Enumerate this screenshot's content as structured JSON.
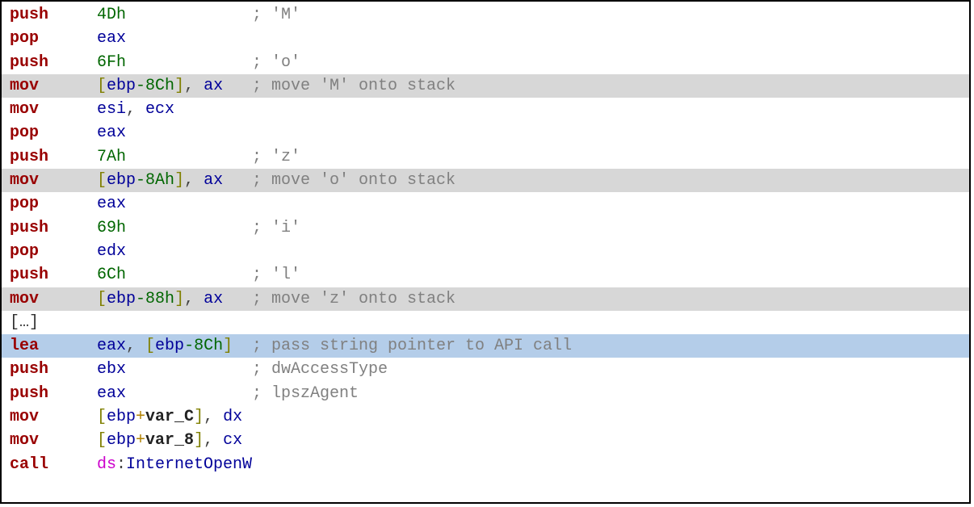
{
  "lines": [
    {
      "hl": "",
      "op": "push",
      "args": [
        {
          "t": "num",
          "v": "4Dh"
        },
        {
          "t": "txt",
          "v": " "
        }
      ],
      "rest": [
        {
          "t": "comment",
          "v": "; 'M'"
        }
      ]
    },
    {
      "hl": "",
      "op": "pop",
      "args": [
        {
          "t": "reg",
          "v": "eax"
        }
      ],
      "rest": []
    },
    {
      "hl": "",
      "op": "push",
      "args": [
        {
          "t": "num",
          "v": "6Fh"
        },
        {
          "t": "txt",
          "v": " "
        }
      ],
      "rest": [
        {
          "t": "comment",
          "v": "; 'o'"
        }
      ]
    },
    {
      "hl": "gray",
      "op": "mov",
      "args": [
        {
          "t": "bracket",
          "v": "["
        },
        {
          "t": "reg",
          "v": "ebp"
        },
        {
          "t": "minus",
          "v": "-"
        },
        {
          "t": "num",
          "v": "8Ch"
        },
        {
          "t": "bracket",
          "v": "]"
        },
        {
          "t": "punct",
          "v": ", "
        },
        {
          "t": "reg",
          "v": "ax"
        }
      ],
      "rest": [
        {
          "t": "comment",
          "v": "; move 'M' onto stack"
        }
      ]
    },
    {
      "hl": "",
      "op": "mov",
      "args": [
        {
          "t": "reg",
          "v": "esi"
        },
        {
          "t": "punct",
          "v": ", "
        },
        {
          "t": "reg",
          "v": "ecx"
        }
      ],
      "rest": []
    },
    {
      "hl": "",
      "op": "pop",
      "args": [
        {
          "t": "reg",
          "v": "eax"
        }
      ],
      "rest": []
    },
    {
      "hl": "",
      "op": "push",
      "args": [
        {
          "t": "num",
          "v": "7Ah"
        },
        {
          "t": "txt",
          "v": " "
        }
      ],
      "rest": [
        {
          "t": "comment",
          "v": "; 'z'"
        }
      ]
    },
    {
      "hl": "gray",
      "op": "mov",
      "args": [
        {
          "t": "bracket",
          "v": "["
        },
        {
          "t": "reg",
          "v": "ebp"
        },
        {
          "t": "minus",
          "v": "-"
        },
        {
          "t": "num",
          "v": "8Ah"
        },
        {
          "t": "bracket",
          "v": "]"
        },
        {
          "t": "punct",
          "v": ", "
        },
        {
          "t": "reg",
          "v": "ax"
        }
      ],
      "rest": [
        {
          "t": "comment",
          "v": "; move 'o' onto stack"
        }
      ]
    },
    {
      "hl": "",
      "op": "pop",
      "args": [
        {
          "t": "reg",
          "v": "eax"
        }
      ],
      "rest": []
    },
    {
      "hl": "",
      "op": "push",
      "args": [
        {
          "t": "num",
          "v": "69h"
        },
        {
          "t": "txt",
          "v": " "
        }
      ],
      "rest": [
        {
          "t": "comment",
          "v": "; 'i'"
        }
      ]
    },
    {
      "hl": "",
      "op": "pop",
      "args": [
        {
          "t": "reg",
          "v": "edx"
        }
      ],
      "rest": []
    },
    {
      "hl": "",
      "op": "push",
      "args": [
        {
          "t": "num",
          "v": "6Ch"
        },
        {
          "t": "txt",
          "v": " "
        }
      ],
      "rest": [
        {
          "t": "comment",
          "v": "; 'l'"
        }
      ]
    },
    {
      "hl": "gray",
      "op": "mov",
      "args": [
        {
          "t": "bracket",
          "v": "["
        },
        {
          "t": "reg",
          "v": "ebp"
        },
        {
          "t": "minus",
          "v": "-"
        },
        {
          "t": "num",
          "v": "88h"
        },
        {
          "t": "bracket",
          "v": "]"
        },
        {
          "t": "punct",
          "v": ", "
        },
        {
          "t": "reg",
          "v": "ax"
        }
      ],
      "rest": [
        {
          "t": "comment",
          "v": "; move 'z' onto stack"
        }
      ]
    },
    {
      "hl": "",
      "op": "",
      "args": [],
      "rest": [],
      "ellipsis": "[…]"
    },
    {
      "hl": "blue",
      "op": "lea",
      "args": [
        {
          "t": "reg",
          "v": "eax"
        },
        {
          "t": "punct",
          "v": ", "
        },
        {
          "t": "bracket",
          "v": "["
        },
        {
          "t": "reg",
          "v": "ebp"
        },
        {
          "t": "minus",
          "v": "-"
        },
        {
          "t": "num",
          "v": "8Ch"
        },
        {
          "t": "bracket",
          "v": "]"
        }
      ],
      "rest": [
        {
          "t": "comment",
          "v": "; pass string pointer to API call"
        }
      ]
    },
    {
      "hl": "",
      "op": "push",
      "args": [
        {
          "t": "reg",
          "v": "ebx"
        }
      ],
      "rest": [
        {
          "t": "comment",
          "v": "; dwAccessType"
        }
      ]
    },
    {
      "hl": "",
      "op": "push",
      "args": [
        {
          "t": "reg",
          "v": "eax"
        }
      ],
      "rest": [
        {
          "t": "comment",
          "v": "; lpszAgent"
        }
      ]
    },
    {
      "hl": "",
      "op": "mov",
      "args": [
        {
          "t": "bracket",
          "v": "["
        },
        {
          "t": "reg",
          "v": "ebp"
        },
        {
          "t": "plus",
          "v": "+"
        },
        {
          "t": "varname",
          "v": "var_C"
        },
        {
          "t": "bracket",
          "v": "]"
        },
        {
          "t": "punct",
          "v": ", "
        },
        {
          "t": "reg",
          "v": "dx"
        }
      ],
      "rest": []
    },
    {
      "hl": "",
      "op": "mov",
      "args": [
        {
          "t": "bracket",
          "v": "["
        },
        {
          "t": "reg",
          "v": "ebp"
        },
        {
          "t": "plus",
          "v": "+"
        },
        {
          "t": "varname",
          "v": "var_8"
        },
        {
          "t": "bracket",
          "v": "]"
        },
        {
          "t": "punct",
          "v": ", "
        },
        {
          "t": "reg",
          "v": "cx"
        }
      ],
      "rest": []
    },
    {
      "hl": "",
      "op": "call",
      "args": [
        {
          "t": "seg",
          "v": "ds"
        },
        {
          "t": "punct",
          "v": ":"
        },
        {
          "t": "apiname",
          "v": "InternetOpenW"
        }
      ],
      "rest": []
    }
  ]
}
